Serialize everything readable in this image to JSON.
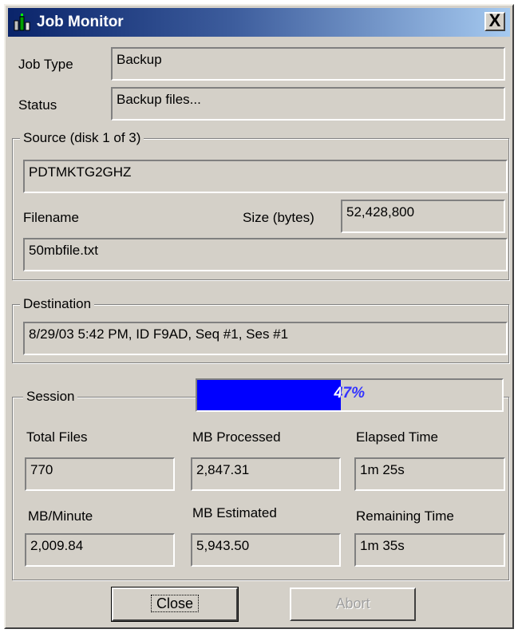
{
  "window": {
    "title": "Job Monitor",
    "close_glyph": "X",
    "icon": "job-monitor-icon"
  },
  "job": {
    "job_type_label": "Job Type",
    "job_type_value": "Backup",
    "status_label": "Status",
    "status_value": "Backup files..."
  },
  "source": {
    "legend": "Source (disk 1 of 3)",
    "machine_value": "PDTMKTG2GHZ",
    "filename_label": "Filename",
    "size_label": "Size (bytes)",
    "size_value": "52,428,800",
    "filename_value": "50mbfile.txt"
  },
  "destination": {
    "legend": "Destination",
    "value": "8/29/03 5:42 PM, ID F9AD, Seq #1, Ses #1"
  },
  "session": {
    "legend": "Session",
    "progress_percent": 47,
    "progress_text": "47%",
    "progress_color": "#0000ff",
    "total_files_label": "Total Files",
    "total_files_value": "770",
    "mb_processed_label": "MB Processed",
    "mb_processed_value": "2,847.31",
    "elapsed_time_label": "Elapsed Time",
    "elapsed_time_value": "1m 25s",
    "mb_minute_label": "MB/Minute",
    "mb_minute_value": "2,009.84",
    "mb_estimated_label": "MB Estimated",
    "mb_estimated_value": "5,943.50",
    "remaining_time_label": "Remaining Time",
    "remaining_time_value": "1m 35s"
  },
  "buttons": {
    "close_label": "Close",
    "abort_label": "Abort"
  }
}
